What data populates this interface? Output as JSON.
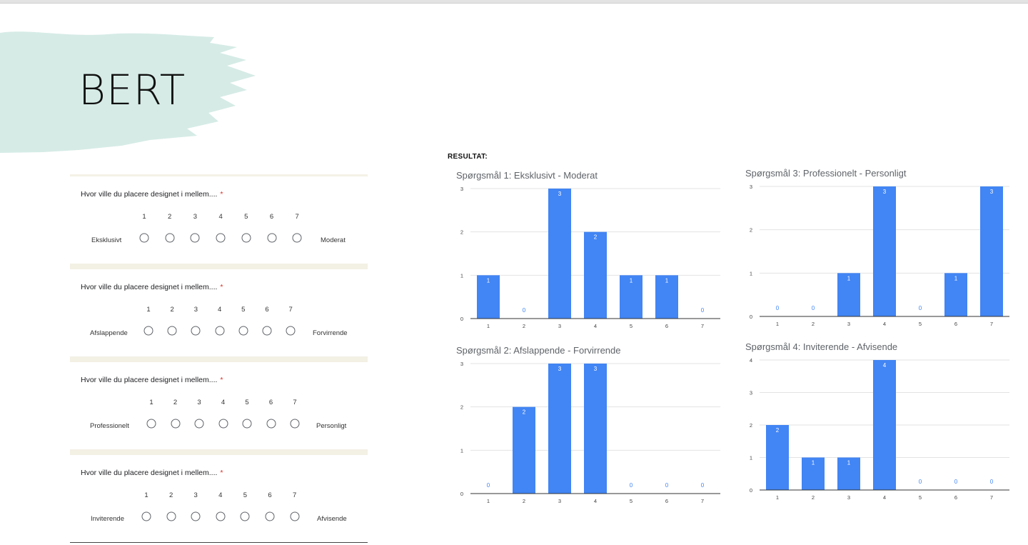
{
  "slide": {
    "title": "BERT",
    "accent_color": "#d6ebe6"
  },
  "form": {
    "questions": [
      {
        "prompt": "Hvor ville du placere designet i mellem....",
        "required_mark": "*",
        "scale": [
          "1",
          "2",
          "3",
          "4",
          "5",
          "6",
          "7"
        ],
        "left_label": "Eksklusivt",
        "right_label": "Moderat"
      },
      {
        "prompt": "Hvor ville du placere designet i mellem....",
        "required_mark": "*",
        "scale": [
          "1",
          "2",
          "3",
          "4",
          "5",
          "6",
          "7"
        ],
        "left_label": "Afslappende",
        "right_label": "Forvirrende"
      },
      {
        "prompt": "Hvor ville du placere designet i mellem....",
        "required_mark": "*",
        "scale": [
          "1",
          "2",
          "3",
          "4",
          "5",
          "6",
          "7"
        ],
        "left_label": "Professionelt",
        "right_label": "Personligt"
      },
      {
        "prompt": "Hvor ville du placere designet i mellem....",
        "required_mark": "*",
        "scale": [
          "1",
          "2",
          "3",
          "4",
          "5",
          "6",
          "7"
        ],
        "left_label": "Inviterende",
        "right_label": "Afvisende"
      }
    ]
  },
  "results": {
    "label": "RESULTAT:"
  },
  "chart_data": [
    {
      "type": "bar",
      "title": "Spørgsmål 1: Eksklusivt - Moderat",
      "categories": [
        "1",
        "2",
        "3",
        "4",
        "5",
        "6",
        "7"
      ],
      "values": [
        1,
        0,
        3,
        2,
        1,
        1,
        0
      ],
      "ylim": [
        0,
        3
      ],
      "yticks": [
        0,
        1,
        2,
        3
      ],
      "grid": true,
      "bar_color": "#4285f4"
    },
    {
      "type": "bar",
      "title": "Spørgsmål 2: Afslappende - Forvirrende",
      "categories": [
        "1",
        "2",
        "3",
        "4",
        "5",
        "6",
        "7"
      ],
      "values": [
        0,
        2,
        3,
        3,
        0,
        0,
        0
      ],
      "ylim": [
        0,
        3
      ],
      "yticks": [
        0,
        1,
        2,
        3
      ],
      "grid": true,
      "bar_color": "#4285f4"
    },
    {
      "type": "bar",
      "title": "Spørgsmål 3: Professionelt - Personligt",
      "categories": [
        "1",
        "2",
        "3",
        "4",
        "5",
        "6",
        "7"
      ],
      "values": [
        0,
        0,
        1,
        3,
        0,
        1,
        3
      ],
      "ylim": [
        0,
        3
      ],
      "yticks": [
        0,
        1,
        2,
        3
      ],
      "grid": true,
      "bar_color": "#4285f4"
    },
    {
      "type": "bar",
      "title": "Spørgsmål 4: Inviterende - Afvisende",
      "categories": [
        "1",
        "2",
        "3",
        "4",
        "5",
        "6",
        "7"
      ],
      "values": [
        2,
        1,
        1,
        4,
        0,
        0,
        0
      ],
      "ylim": [
        0,
        4
      ],
      "yticks": [
        0,
        1,
        2,
        3,
        4
      ],
      "grid": true,
      "bar_color": "#4285f4"
    }
  ]
}
